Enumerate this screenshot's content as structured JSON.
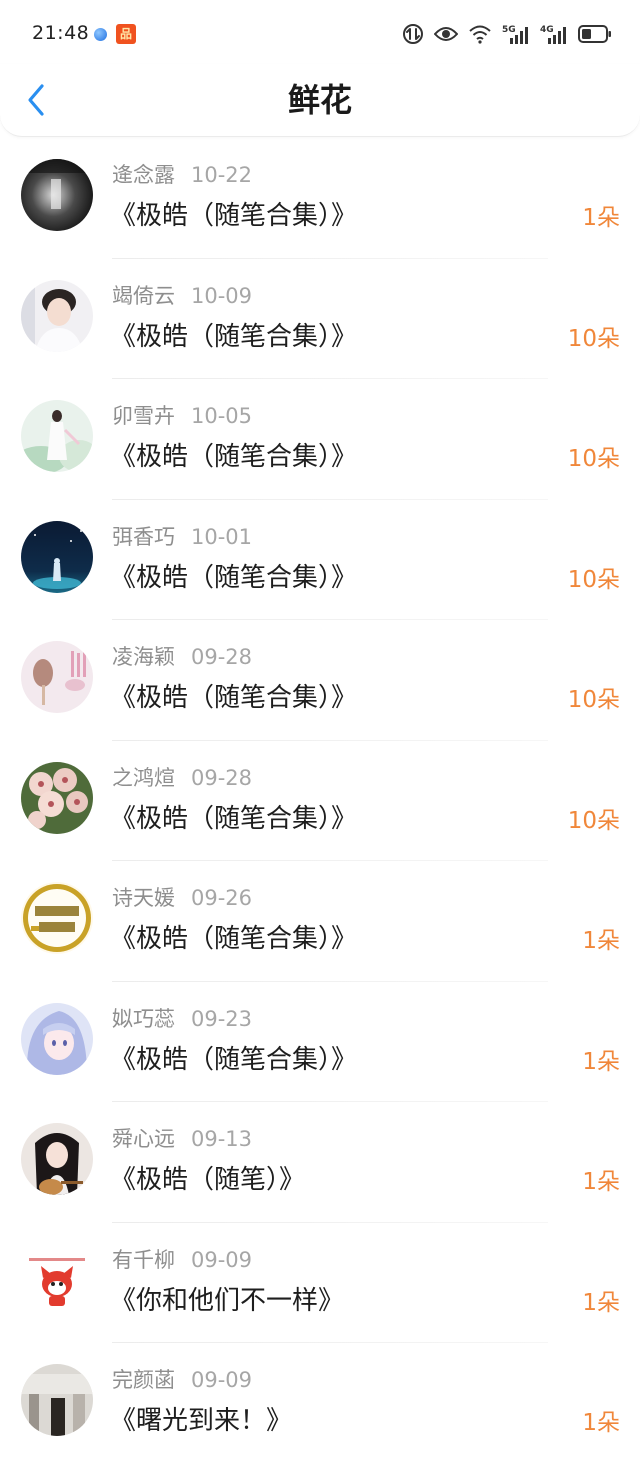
{
  "status_bar": {
    "time": "21:48",
    "badge_text": "品",
    "network_1": "5G",
    "network_2": "4G"
  },
  "header": {
    "title": "鲜花"
  },
  "colors": {
    "accent_blue": "#2a8ff0",
    "count_orange": "#f0873a"
  },
  "items": [
    {
      "name": "逄念露",
      "date": "10-22",
      "book": "《极皓（随笔合集）》",
      "count": "1朵"
    },
    {
      "name": "竭倚云",
      "date": "10-09",
      "book": "《极皓（随笔合集）》",
      "count": "10朵"
    },
    {
      "name": "卯雪卉",
      "date": "10-05",
      "book": "《极皓（随笔合集）》",
      "count": "10朵"
    },
    {
      "name": "弭香巧",
      "date": "10-01",
      "book": "《极皓（随笔合集）》",
      "count": "10朵"
    },
    {
      "name": "凌海颖",
      "date": "09-28",
      "book": "《极皓（随笔合集）》",
      "count": "10朵"
    },
    {
      "name": "之鸿煊",
      "date": "09-28",
      "book": "《极皓（随笔合集）》",
      "count": "10朵"
    },
    {
      "name": "诗天媛",
      "date": "09-26",
      "book": "《极皓（随笔合集）》",
      "count": "1朵"
    },
    {
      "name": "姒巧蕊",
      "date": "09-23",
      "book": "《极皓（随笔合集）》",
      "count": "1朵"
    },
    {
      "name": "舜心远",
      "date": "09-13",
      "book": "《极皓（随笔）》",
      "count": "1朵"
    },
    {
      "name": "有千柳",
      "date": "09-09",
      "book": "《你和他们不一样》",
      "count": "1朵"
    },
    {
      "name": "完颜菡",
      "date": "09-09",
      "book": "《曙光到来！》",
      "count": "1朵"
    }
  ]
}
